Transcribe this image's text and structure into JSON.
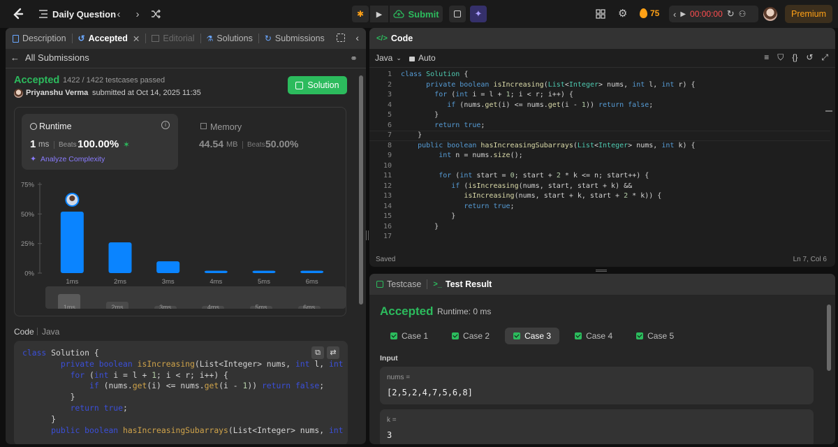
{
  "topbar": {
    "title": "Daily Question",
    "submit_label": "Submit",
    "streak": "75",
    "timer": "00:00:00",
    "premium_label": "Premium"
  },
  "left": {
    "tabs": [
      {
        "label": "Description"
      },
      {
        "label": "Accepted"
      },
      {
        "label": "Editorial"
      },
      {
        "label": "Solutions"
      },
      {
        "label": "Submissions"
      }
    ],
    "back_label": "All Submissions",
    "status": "Accepted",
    "testcases": "1422 / 1422 testcases passed",
    "author": "Priyanshu Verma",
    "submitted": "submitted at Oct 14, 2025 11:35",
    "solution_button": "Solution",
    "runtime": {
      "title": "Runtime",
      "value": "1",
      "unit": "ms",
      "beats_label": "Beats",
      "beats": "100.00%",
      "analyze": "Analyze Complexity"
    },
    "memory": {
      "title": "Memory",
      "value": "44.54",
      "unit": "MB",
      "beats_label": "Beats",
      "beats": "50.00%"
    },
    "code_header": "Code",
    "code_lang": "Java",
    "code_lines": [
      [
        [
          "kw",
          "class "
        ],
        [
          "ty",
          "Solution "
        ],
        [
          "tx",
          "{"
        ]
      ],
      [
        [
          "tx",
          "        "
        ],
        [
          "kw",
          "private boolean "
        ],
        [
          "fn",
          "isIncreasing"
        ],
        [
          "tx",
          "("
        ],
        [
          "ty",
          "List"
        ],
        [
          "tx",
          "<"
        ],
        [
          "ty",
          "Integer"
        ],
        [
          "tx",
          "> nums, "
        ],
        [
          "kw",
          "int "
        ],
        [
          "tx",
          "l, "
        ],
        [
          "kw",
          "int "
        ],
        [
          "tx",
          "r) {"
        ]
      ],
      [
        [
          "tx",
          "          "
        ],
        [
          "kw",
          "for "
        ],
        [
          "tx",
          "("
        ],
        [
          "kw",
          "int "
        ],
        [
          "tx",
          "i = l + "
        ],
        [
          "nm",
          "1"
        ],
        [
          "tx",
          "; i < r; i++) {"
        ]
      ],
      [
        [
          "tx",
          "              "
        ],
        [
          "kw",
          "if "
        ],
        [
          "tx",
          "(nums."
        ],
        [
          "fn",
          "get"
        ],
        [
          "tx",
          "(i) <= nums."
        ],
        [
          "fn",
          "get"
        ],
        [
          "tx",
          "(i - "
        ],
        [
          "nm",
          "1"
        ],
        [
          "tx",
          ")) "
        ],
        [
          "kw",
          "return false"
        ],
        [
          "tx",
          ";"
        ]
      ],
      [
        [
          "tx",
          "          }"
        ]
      ],
      [
        [
          "tx",
          "          "
        ],
        [
          "kw",
          "return true"
        ],
        [
          "tx",
          ";"
        ]
      ],
      [
        [
          "tx",
          "      }"
        ]
      ],
      [
        [
          "tx",
          "      "
        ],
        [
          "kw",
          "public boolean "
        ],
        [
          "fn",
          "hasIncreasingSubarrays"
        ],
        [
          "tx",
          "("
        ],
        [
          "ty",
          "List"
        ],
        [
          "tx",
          "<"
        ],
        [
          "ty",
          "Integer"
        ],
        [
          "tx",
          "> nums, "
        ],
        [
          "kw",
          "int "
        ],
        [
          "tx",
          "k) {"
        ]
      ]
    ]
  },
  "chart_data": {
    "type": "bar",
    "categories": [
      "1ms",
      "2ms",
      "3ms",
      "4ms",
      "5ms",
      "6ms"
    ],
    "values": [
      52,
      26,
      10,
      2,
      2,
      2
    ],
    "ylim": [
      0,
      75
    ],
    "yticks": [
      "75%",
      "50%",
      "25%",
      "0%"
    ],
    "highlight_index": 0
  },
  "editor": {
    "title": "Code",
    "lang": "Java",
    "mode": "Auto",
    "status_left": "Saved",
    "status_right": "Ln 7, Col 6",
    "line_numbers": [
      "1",
      "2",
      "3",
      "4",
      "5",
      "6",
      "7",
      "8",
      "9",
      "10",
      "11",
      "12",
      "13",
      "14",
      "15",
      "16",
      "17"
    ],
    "lines": [
      [
        [
          "kw",
          "class "
        ],
        [
          "ty",
          "Solution "
        ],
        [
          "tx",
          "{"
        ]
      ],
      [
        [
          "tx",
          "      "
        ],
        [
          "kw",
          "private boolean "
        ],
        [
          "fn",
          "isIncreasing"
        ],
        [
          "tx",
          "("
        ],
        [
          "ty",
          "List"
        ],
        [
          "tx",
          "<"
        ],
        [
          "ty",
          "Integer"
        ],
        [
          "tx",
          "> nums, "
        ],
        [
          "kw",
          "int "
        ],
        [
          "tx",
          "l, "
        ],
        [
          "kw",
          "int "
        ],
        [
          "tx",
          "r) {"
        ]
      ],
      [
        [
          "tx",
          "        "
        ],
        [
          "kw",
          "for "
        ],
        [
          "tx",
          "("
        ],
        [
          "kw",
          "int "
        ],
        [
          "tx",
          "i = l + "
        ],
        [
          "nm",
          "1"
        ],
        [
          "tx",
          "; i < r; i++) {"
        ]
      ],
      [
        [
          "tx",
          "           "
        ],
        [
          "kw",
          "if "
        ],
        [
          "tx",
          "(nums."
        ],
        [
          "fn",
          "get"
        ],
        [
          "tx",
          "(i) <= nums."
        ],
        [
          "fn",
          "get"
        ],
        [
          "tx",
          "(i - "
        ],
        [
          "nm",
          "1"
        ],
        [
          "tx",
          ")) "
        ],
        [
          "kw",
          "return false"
        ],
        [
          "tx",
          ";"
        ]
      ],
      [
        [
          "tx",
          "        }"
        ]
      ],
      [
        [
          "tx",
          "        "
        ],
        [
          "kw",
          "return true"
        ],
        [
          "tx",
          ";"
        ]
      ],
      [
        [
          "tx",
          "    }"
        ]
      ],
      [
        [
          "tx",
          "    "
        ],
        [
          "kw",
          "public boolean "
        ],
        [
          "fn",
          "hasIncreasingSubarrays"
        ],
        [
          "tx",
          "("
        ],
        [
          "ty",
          "List"
        ],
        [
          "tx",
          "<"
        ],
        [
          "ty",
          "Integer"
        ],
        [
          "tx",
          "> nums, "
        ],
        [
          "kw",
          "int "
        ],
        [
          "tx",
          "k) {"
        ]
      ],
      [
        [
          "tx",
          "         "
        ],
        [
          "kw",
          "int "
        ],
        [
          "tx",
          "n = nums."
        ],
        [
          "fn",
          "size"
        ],
        [
          "tx",
          "();"
        ]
      ],
      [
        [
          "tx",
          ""
        ]
      ],
      [
        [
          "tx",
          "         "
        ],
        [
          "kw",
          "for "
        ],
        [
          "tx",
          "("
        ],
        [
          "kw",
          "int "
        ],
        [
          "tx",
          "start = "
        ],
        [
          "nm",
          "0"
        ],
        [
          "tx",
          "; start + "
        ],
        [
          "nm",
          "2"
        ],
        [
          "tx",
          " * k <= n; start++) {"
        ]
      ],
      [
        [
          "tx",
          "            "
        ],
        [
          "kw",
          "if "
        ],
        [
          "tx",
          "("
        ],
        [
          "fn",
          "isIncreasing"
        ],
        [
          "tx",
          "(nums, start, start + k) &&"
        ]
      ],
      [
        [
          "tx",
          "               "
        ],
        [
          "fn",
          "isIncreasing"
        ],
        [
          "tx",
          "(nums, start + k, start + "
        ],
        [
          "nm",
          "2"
        ],
        [
          "tx",
          " * k)) {"
        ]
      ],
      [
        [
          "tx",
          "               "
        ],
        [
          "kw",
          "return true"
        ],
        [
          "tx",
          ";"
        ]
      ],
      [
        [
          "tx",
          "            }"
        ]
      ],
      [
        [
          "tx",
          "        }"
        ]
      ],
      [
        [
          "tx",
          ""
        ]
      ]
    ]
  },
  "testpanel": {
    "tab_testcase": "Testcase",
    "tab_result": "Test Result",
    "status": "Accepted",
    "runtime": "Runtime: 0 ms",
    "cases": [
      "Case 1",
      "Case 2",
      "Case 3",
      "Case 4",
      "Case 5"
    ],
    "selected_case": 2,
    "input_label": "Input",
    "nums_label": "nums =",
    "nums_value": "[2,5,2,4,7,5,6,8]",
    "k_label": "k =",
    "k_value": "3"
  },
  "colors": {
    "accent_green": "#2cbb5d",
    "bar_blue": "#0a84ff",
    "streak_orange": "#ffa116"
  }
}
